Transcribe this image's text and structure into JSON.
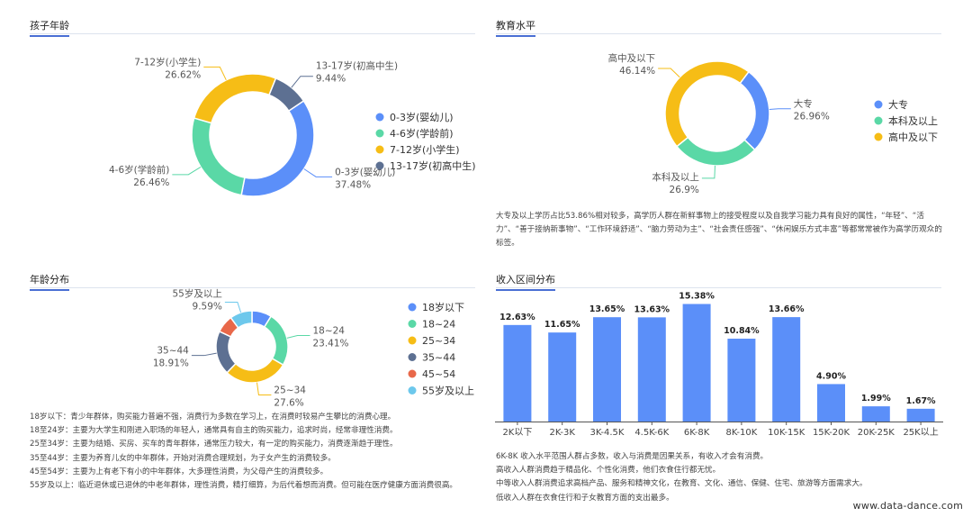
{
  "colors": {
    "blue": "#5b8ff9",
    "green": "#5ad8a6",
    "yellow": "#f6bd16",
    "navy": "#5d7092",
    "red": "#e8684a",
    "sky": "#6dc8ec",
    "bar": "#5b8ff9"
  },
  "watermark": "www.data-dance.com",
  "panels": {
    "child_age": {
      "title": "孩子年龄",
      "chart_data": {
        "type": "pie",
        "categories": [
          "0-3岁(婴幼儿)",
          "4-6岁(学龄前)",
          "7-12岁(小学生)",
          "13-17岁(初高中生)"
        ],
        "values": [
          37.48,
          26.46,
          26.62,
          9.44
        ],
        "value_labels": [
          "37.48%",
          "26.46%",
          "26.62%",
          "9.44%"
        ],
        "colors": [
          "#5b8ff9",
          "#5ad8a6",
          "#f6bd16",
          "#5d7092"
        ],
        "legend": [
          "0-3岁(婴幼儿)",
          "4-6岁(学龄前)",
          "7-12岁(小学生)",
          "13-17岁(初高中生)"
        ],
        "legend_position": "right"
      }
    },
    "education": {
      "title": "教育水平",
      "chart_data": {
        "type": "pie",
        "categories": [
          "大专",
          "本科及以上",
          "高中及以下"
        ],
        "values": [
          26.96,
          26.9,
          46.14
        ],
        "value_labels": [
          "26.96%",
          "26.9%",
          "46.14%"
        ],
        "colors": [
          "#5b8ff9",
          "#5ad8a6",
          "#f6bd16"
        ],
        "legend": [
          "大专",
          "本科及以上",
          "高中及以下"
        ],
        "legend_position": "right"
      },
      "description": [
        "大专及以上学历占比53.86%相对较多，高学历人群在新鲜事物上的接受程度以及自我学习能力具有良好的属性，“年轻”、“活力”、“善于接纳新事物”、“工作环境舒适”、“脑力劳动为主”、“社会责任感强”、“休闲娱乐方式丰富”等都常常被作为高学历观众的标签。"
      ]
    },
    "age_dist": {
      "title": "年龄分布",
      "chart_data": {
        "type": "pie",
        "categories": [
          "18岁以下",
          "18~24",
          "25~34",
          "35~44",
          "45~54",
          "55岁及以上"
        ],
        "values": [
          8.5,
          23.41,
          27.6,
          18.91,
          7.6,
          9.59
        ],
        "value_labels": [
          "",
          "23.41%",
          "27.6%",
          "18.91%",
          "",
          "9.59%"
        ],
        "colors": [
          "#5b8ff9",
          "#5ad8a6",
          "#f6bd16",
          "#5d7092",
          "#e8684a",
          "#6dc8ec"
        ],
        "legend": [
          "18岁以下",
          "18~24",
          "25~34",
          "35~44",
          "45~54",
          "55岁及以上"
        ],
        "legend_position": "right"
      },
      "description": [
        "18岁以下：青少年群体，购买能力普遍不强，消费行为多数在学习上，在消费时较易产生攀比的消费心理。",
        "18至24岁：主要为大学生和刚进入职场的年轻人，通常具有自主的购买能力，追求时尚，经常非理性消费。",
        "25至34岁：主要为结婚、买房、买车的青年群体，通常压力较大，有一定的购买能力，消费逐渐趋于理性。",
        "35至44岁：主要为养育儿女的中年群体，开始对消费合理规划，为子女产生的消费较多。",
        "45至54岁：主要为上有老下有小的中年群体，大多理性消费，为父母产生的消费较多。",
        "55岁及以上：临近退休或已退休的中老年群体，理性消费，精打细算，为后代着想而消费。但可能在医疗健康方面消费很高。"
      ]
    },
    "income": {
      "title": "收入区间分布",
      "chart_data": {
        "type": "bar",
        "categories": [
          "2K以下",
          "2K-3K",
          "3K-4.5K",
          "4.5K-6K",
          "6K-8K",
          "8K-10K",
          "10K-15K",
          "15K-20K",
          "20K-25K",
          "25K以上"
        ],
        "values": [
          12.63,
          11.65,
          13.65,
          13.63,
          15.38,
          10.84,
          13.66,
          4.9,
          1.99,
          1.67
        ],
        "value_labels": [
          "12.63%",
          "11.65%",
          "13.65%",
          "13.63%",
          "15.38%",
          "10.84%",
          "13.66%",
          "4.90%",
          "1.99%",
          "1.67%"
        ],
        "ylim": [
          0,
          16.5
        ],
        "grid": false
      },
      "description": [
        "6K-8K 收入水平范围人群占多数，收入与消费是因果关系，有收入才会有消费。",
        "高收入人群消费趋于精品化、个性化消费，他们衣食住行都无忧。",
        "中等收入人群消费追求高档产品、服务和精神文化，在教育、文化、通信、保健、住宅、旅游等方面需求大。",
        "低收入人群在衣食住行和子女教育方面的支出最多。"
      ]
    }
  }
}
